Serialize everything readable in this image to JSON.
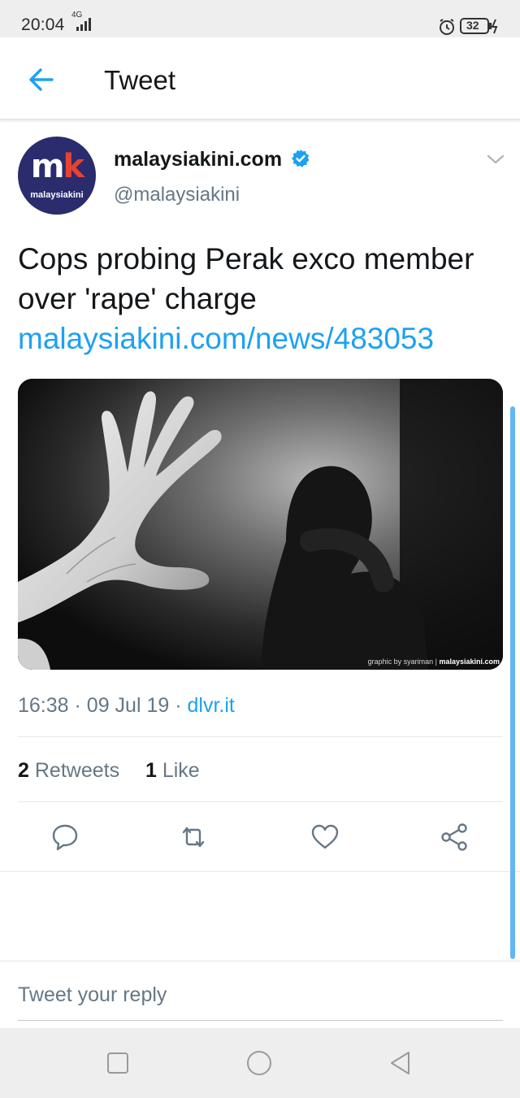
{
  "status_bar": {
    "time": "20:04",
    "network": "4G",
    "battery": "32"
  },
  "header": {
    "title": "Tweet",
    "back_icon": "arrow-left-icon"
  },
  "tweet": {
    "author": {
      "name": "malaysiakini.com",
      "handle": "@malaysiakini",
      "verified": true,
      "avatar_logo_main": "m",
      "avatar_logo_accent": "k",
      "avatar_logo_sub": "malaysiakini"
    },
    "text": "Cops probing Perak exco member over 'rape' charge",
    "link": "malaysiakini.com/news/483053",
    "media": {
      "credit_prefix": "graphic by syariman | ",
      "credit_brand": "malaysiakini.com"
    },
    "time": "16:38",
    "date": "09 Jul 19",
    "source": "dlvr.it",
    "retweets_count": "2",
    "retweets_label": "Retweets",
    "likes_count": "1",
    "likes_label": "Like"
  },
  "actions": [
    "reply-icon",
    "retweet-icon",
    "like-icon",
    "share-icon"
  ],
  "reply": {
    "placeholder": "Tweet your reply"
  },
  "colors": {
    "accent": "#1da1f2",
    "text_primary": "#14171a",
    "text_secondary": "#657786",
    "avatar_bg": "#2a2c6e",
    "logo_accent": "#e8432f"
  }
}
